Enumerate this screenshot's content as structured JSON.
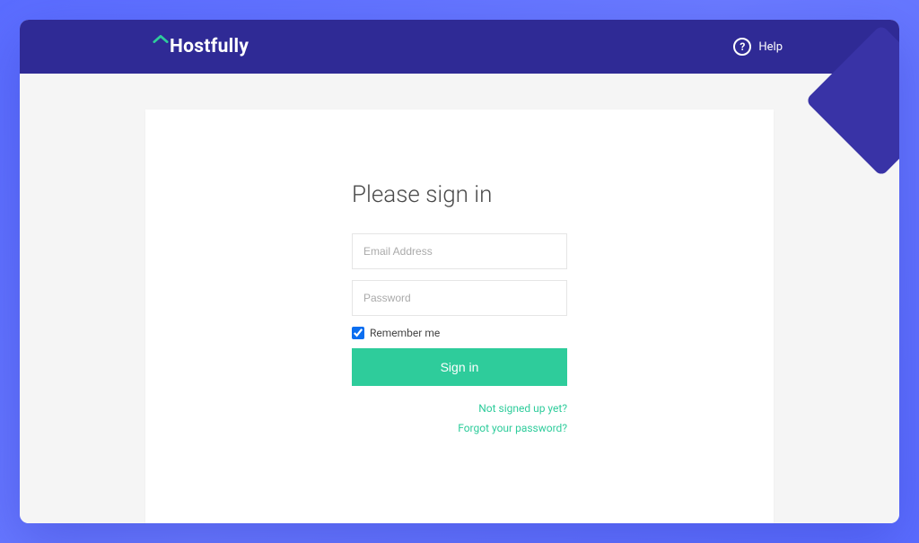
{
  "header": {
    "logo_text": "Hostfully",
    "help_label": "Help"
  },
  "signin": {
    "title": "Please sign in",
    "email_placeholder": "Email Address",
    "email_value": "",
    "password_placeholder": "Password",
    "password_value": "",
    "remember_label": "Remember me",
    "remember_checked": true,
    "submit_label": "Sign in",
    "signup_link": "Not signed up yet?",
    "forgot_link": "Forgot your password?"
  },
  "colors": {
    "header_bg": "#2f2a95",
    "accent_green": "#2ecc9b"
  }
}
